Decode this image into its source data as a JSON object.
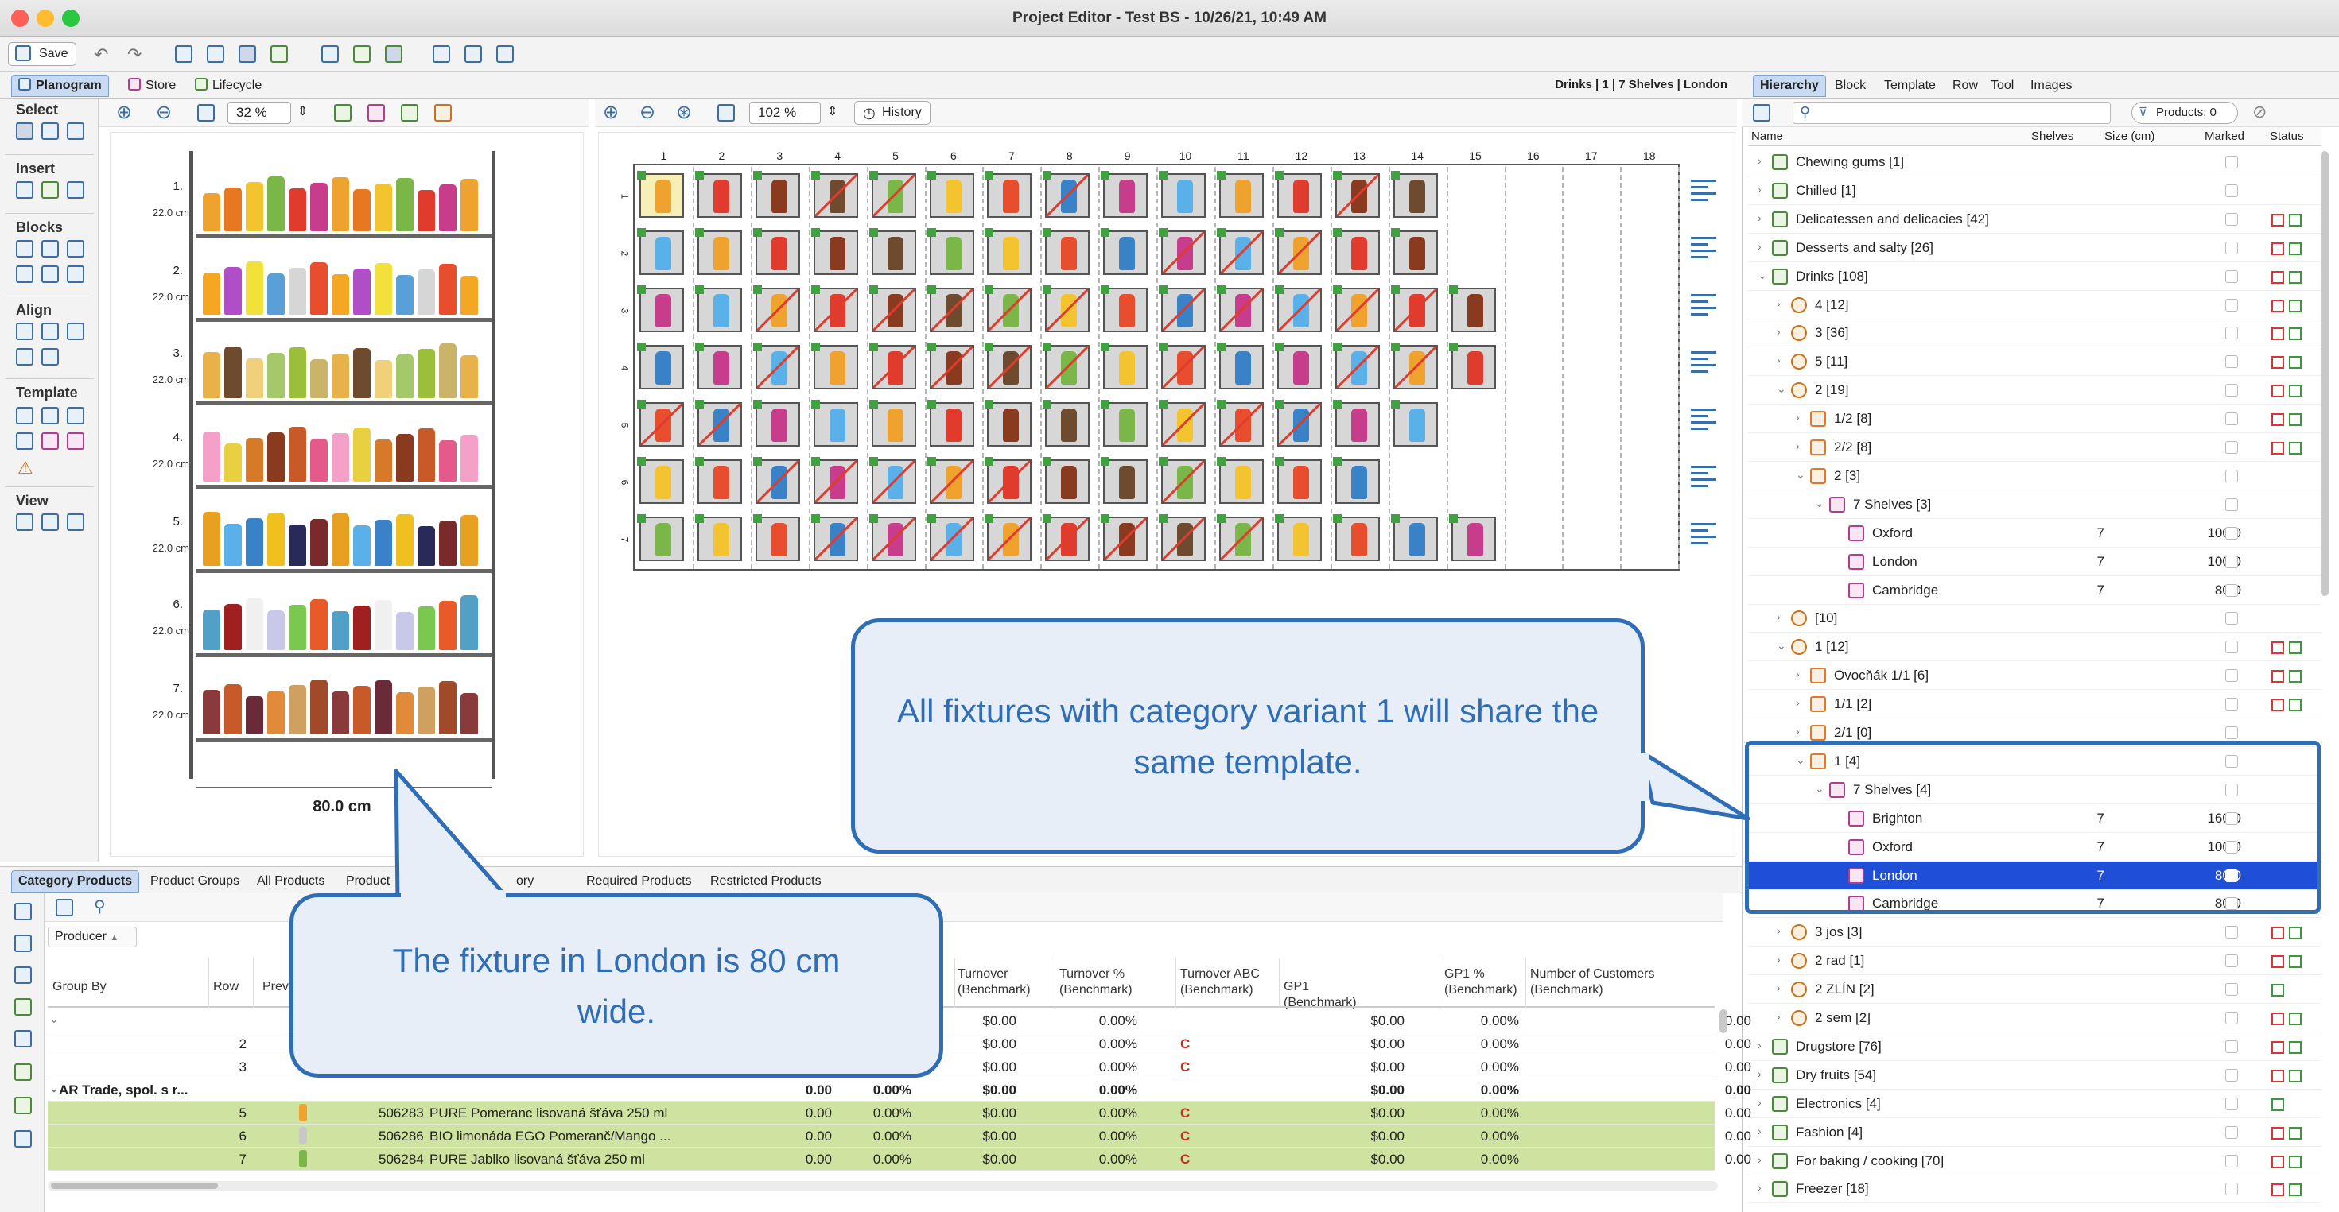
{
  "window": {
    "title": "Project Editor - Test BS - 10/26/21, 10:49 AM"
  },
  "toolbar": {
    "save": "Save"
  },
  "left_tabs": [
    "Planogram",
    "Store",
    "Lifecycle"
  ],
  "tool_groups": {
    "select": "Select",
    "insert": "Insert",
    "blocks": "Blocks",
    "align": "Align",
    "template": "Template",
    "view": "View"
  },
  "zoom": {
    "left": "32 %",
    "right": "102 %",
    "history": "History"
  },
  "breadcrumb": "Drinks | 1 | 7 Shelves | London",
  "shelf": {
    "numbers": [
      "1.",
      "2.",
      "3.",
      "4.",
      "5.",
      "6.",
      "7."
    ],
    "height_label": "22.0 cm",
    "width_label": "80.0 cm"
  },
  "grid": {
    "columns": [
      "1",
      "2",
      "3",
      "4",
      "5",
      "6",
      "7",
      "8",
      "9",
      "10",
      "11",
      "12",
      "13",
      "14",
      "15",
      "16",
      "17",
      "18"
    ],
    "rows": [
      "1",
      "2",
      "3",
      "4",
      "5",
      "6",
      "7"
    ]
  },
  "right_tabs": [
    "Hierarchy",
    "Block",
    "Template",
    "Row",
    "Tool",
    "Images"
  ],
  "products_filter": "Products: 0",
  "hier_headers": {
    "name": "Name",
    "shelves": "Shelves",
    "size": "Size (cm)",
    "marked": "Marked",
    "status": "Status"
  },
  "hierarchy": [
    {
      "label": "Chewing gums [1]"
    },
    {
      "label": "Chilled [1]"
    },
    {
      "label": "Delicatessen and delicacies [42]"
    },
    {
      "label": "Desserts and salty [26]"
    },
    {
      "label": "Drinks [108]"
    },
    {
      "label": "4 [12]"
    },
    {
      "label": "3 [36]"
    },
    {
      "label": "5 [11]"
    },
    {
      "label": "2 [19]"
    },
    {
      "label": "1/2 [8]"
    },
    {
      "label": "2/2 [8]"
    },
    {
      "label": "2 [3]"
    },
    {
      "label": "7 Shelves [3]"
    },
    {
      "label": "Oxford",
      "shelves": "7",
      "size": "100.0"
    },
    {
      "label": "London",
      "shelves": "7",
      "size": "100.0"
    },
    {
      "label": "Cambridge",
      "shelves": "7",
      "size": "80.0"
    },
    {
      "label": "[10]"
    },
    {
      "label": "1 [12]"
    },
    {
      "label": "Ovocňák 1/1 [6]"
    },
    {
      "label": "1/1 [2]"
    },
    {
      "label": "2/1 [0]"
    },
    {
      "label": "1 [4]"
    },
    {
      "label": "7 Shelves [4]"
    },
    {
      "label": "Brighton",
      "shelves": "7",
      "size": "160.0"
    },
    {
      "label": "Oxford",
      "shelves": "7",
      "size": "100.0"
    },
    {
      "label": "London",
      "shelves": "7",
      "size": "80.0"
    },
    {
      "label": "Cambridge",
      "shelves": "7",
      "size": "80.0"
    },
    {
      "label": "3 jos [3]"
    },
    {
      "label": "2 rad [1]"
    },
    {
      "label": "2 ZLÍN [2]"
    },
    {
      "label": "2 sem [2]"
    },
    {
      "label": "Drugstore [76]"
    },
    {
      "label": "Dry fruits [54]"
    },
    {
      "label": "Electronics [4]"
    },
    {
      "label": "Fashion [4]"
    },
    {
      "label": "For baking / cooking [70]"
    },
    {
      "label": "Freezer [18]"
    }
  ],
  "bottom_tabs": [
    "Category Products",
    "Product Groups",
    "All Products",
    "Product",
    "ory",
    "Required Products",
    "Restricted Products"
  ],
  "table": {
    "producer": "Producer",
    "headers": [
      "Group By",
      "Row",
      "Prev",
      "Turnover (Benchmark)",
      "Turnover % (Benchmark)",
      "Turnover ABC (Benchmark)",
      "GP1 (Benchmark)",
      "GP1 % (Benchmark)",
      "Number of Customers (Benchmark)"
    ],
    "rows": [
      {
        "group": "",
        "row": "",
        "code": "",
        "name": "",
        "a": "",
        "b": "%",
        "t": "$0.00",
        "tp": "0.00%",
        "abc": "",
        "gp": "$0.00",
        "gpp": "0.00%",
        "nc": "0.00"
      },
      {
        "group": "",
        "row": "2",
        "code": "",
        "name": "",
        "a": "",
        "b": "%",
        "t": "$0.00",
        "tp": "0.00%",
        "abc": "C",
        "gp": "$0.00",
        "gpp": "0.00%",
        "nc": "0.00"
      },
      {
        "group": "",
        "row": "3",
        "code": "",
        "name": "",
        "a": "",
        "b": "%",
        "t": "$0.00",
        "tp": "0.00%",
        "abc": "C",
        "gp": "$0.00",
        "gpp": "0.00%",
        "nc": "0.00"
      },
      {
        "group": "AR Trade, spol. s r...",
        "row": "",
        "code": "",
        "name": "",
        "a": "0.00",
        "b": "0.00%",
        "t": "$0.00",
        "tp": "0.00%",
        "abc": "",
        "gp": "$0.00",
        "gpp": "0.00%",
        "nc": "0.00"
      },
      {
        "group": "",
        "row": "5",
        "code": "506283",
        "name": "PURE Pomeranc lisovaná šťáva 250 ml",
        "a": "0.00",
        "b": "0.00%",
        "t": "$0.00",
        "tp": "0.00%",
        "abc": "C",
        "gp": "$0.00",
        "gpp": "0.00%",
        "nc": "0.00"
      },
      {
        "group": "",
        "row": "6",
        "code": "506286",
        "name": "BIO limonáda EGO Pomeranč/Mango ...",
        "a": "0.00",
        "b": "0.00%",
        "t": "$0.00",
        "tp": "0.00%",
        "abc": "C",
        "gp": "$0.00",
        "gpp": "0.00%",
        "nc": "0.00"
      },
      {
        "group": "",
        "row": "7",
        "code": "506284",
        "name": "PURE Jablko lisovaná šťáva 250 ml",
        "a": "0.00",
        "b": "0.00%",
        "t": "$0.00",
        "tp": "0.00%",
        "abc": "C",
        "gp": "$0.00",
        "gpp": "0.00%",
        "nc": "0.00"
      }
    ]
  },
  "callouts": {
    "template": "All fixtures with category variant 1 will share the same template.",
    "london": "The fixture in London is 80 cm wide."
  },
  "colors": {
    "accent": "#2f6eb5",
    "selection": "#1f4fd6",
    "row_green": "#cfe3a0",
    "status_red": "#d33",
    "status_green": "#3a9a3a"
  }
}
